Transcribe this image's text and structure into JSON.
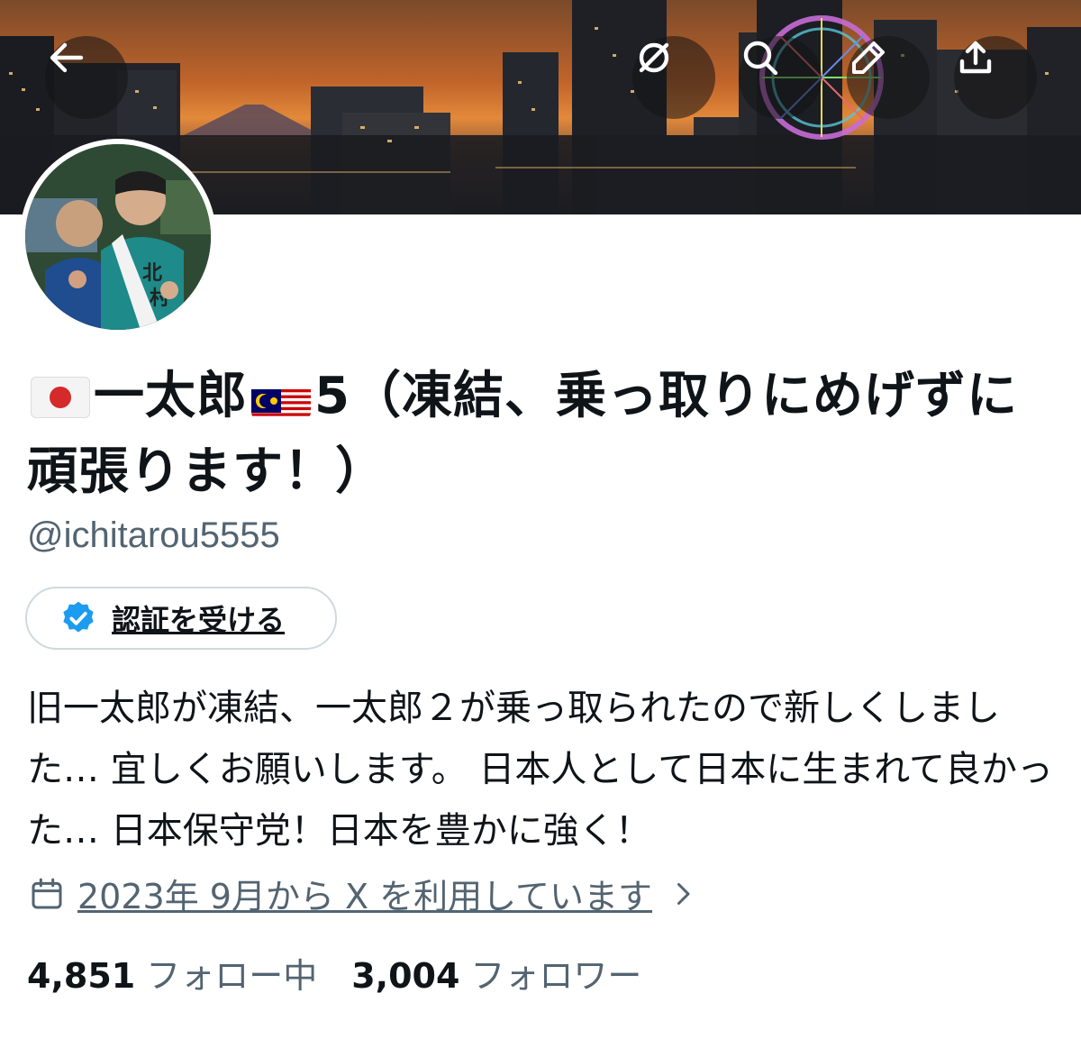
{
  "profile": {
    "display_name_part1": "一太郎",
    "display_name_part2": "5（凍結、乗っ取りにめげずに頑張ります！）",
    "handle": "@ichitarou5555",
    "verify_label": "認証を受ける",
    "bio": "旧一太郎が凍結、一太郎２が乗っ取られたので新しくしました… 宜しくお願いします。 日本人として日本に生まれて良かった… 日本保守党！日本を豊かに強く！",
    "joined": "2023年 9月から X を利用しています",
    "following_count": "4,851",
    "following_label": "フォロー中",
    "followers_count": "3,004",
    "followers_label": "フォロワー"
  },
  "header_icons": [
    "back-arrow-icon",
    "hide-icon",
    "search-icon",
    "edit-icon",
    "share-icon"
  ],
  "colors": {
    "verified_blue": "#1d9bf0",
    "secondary_text": "#536471",
    "primary_text": "#0f1419"
  }
}
